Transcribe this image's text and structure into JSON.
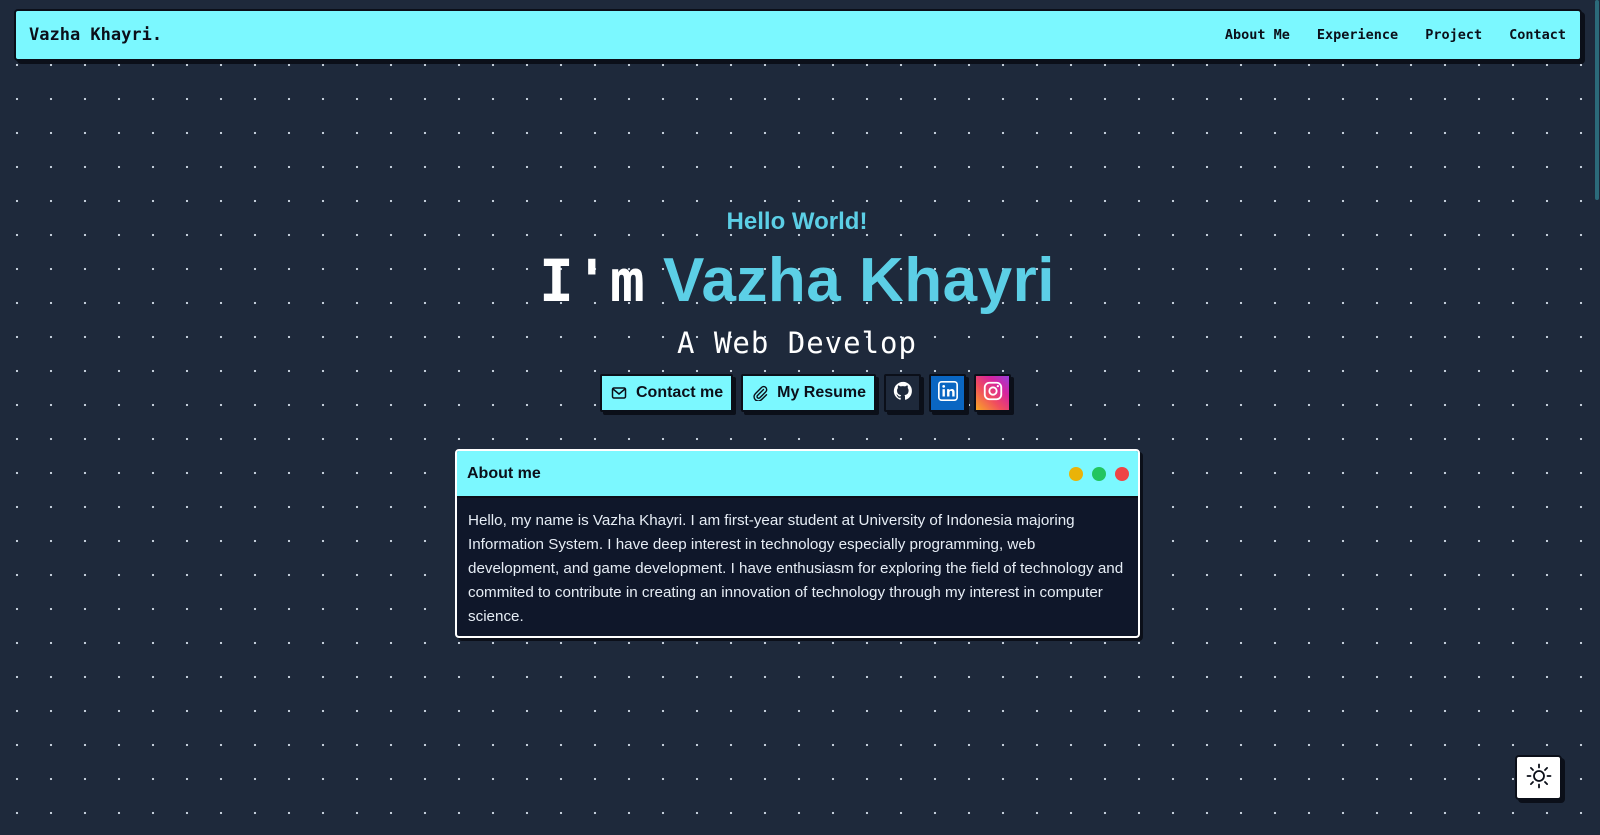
{
  "brand": "Vazha Khayri.",
  "nav": {
    "items": [
      "About Me",
      "Experience",
      "Project",
      "Contact"
    ]
  },
  "hero": {
    "greeting": "Hello World!",
    "headline_lead": "I'm",
    "headline_name": "Vazha Khayri",
    "subtitle": "A Web Develop"
  },
  "actions": {
    "contact_label": "Contact me",
    "resume_label": "My Resume",
    "icons": [
      "mail-icon",
      "paperclip-icon",
      "github-icon",
      "linkedin-icon",
      "instagram-icon"
    ]
  },
  "about_card": {
    "title": "About me",
    "body": "Hello, my name is Vazha Khayri. I am first-year student at University of Indonesia majoring Information System. I have deep interest in technology especially programming, web development, and game development. I have enthusiasm for exploring the field of technology and commited to contribute in creating an innovation of technology through my interest in computer science.",
    "window_dots": [
      "#eab308",
      "#22c55e",
      "#ef4444"
    ]
  },
  "theme_toggle": {
    "icon": "sun-icon"
  },
  "colors": {
    "background": "#1e293b",
    "accent": "#7bf8ff",
    "name_highlight": "#5ccfe6",
    "border": "#0b0f19"
  }
}
